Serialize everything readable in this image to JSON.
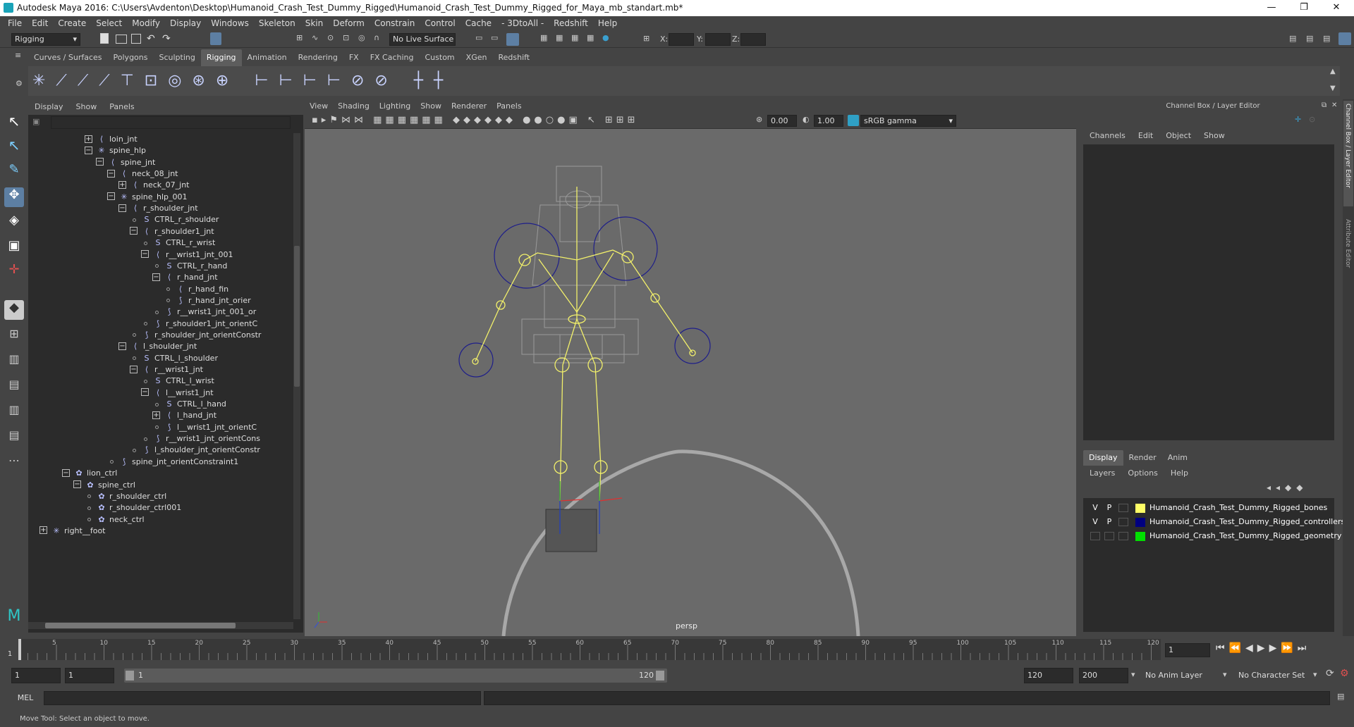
{
  "window": {
    "title": "Autodesk Maya 2016: C:\\Users\\Avdenton\\Desktop\\Humanoid_Crash_Test_Dummy_Rigged\\Humanoid_Crash_Test_Dummy_Rigged_for_Maya_mb_standart.mb*",
    "min": "—",
    "max": "❐",
    "close": "✕"
  },
  "menubar": [
    "File",
    "Edit",
    "Create",
    "Select",
    "Modify",
    "Display",
    "Windows",
    "Skeleton",
    "Skin",
    "Deform",
    "Constrain",
    "Control",
    "Cache",
    "- 3DtoAll -",
    "Redshift",
    "Help"
  ],
  "statusline": {
    "menuset": "Rigging",
    "live_surface": "No Live Surface",
    "x_label": "X:",
    "y_label": "Y:",
    "z_label": "Z:"
  },
  "shelf_tabs": [
    "Curves / Surfaces",
    "Polygons",
    "Sculpting",
    "Rigging",
    "Animation",
    "Rendering",
    "FX",
    "FX Caching",
    "Custom",
    "XGen",
    "Redshift"
  ],
  "active_shelf": "Rigging",
  "outliner": {
    "menu": [
      "Display",
      "Show",
      "Panels"
    ],
    "rows": [
      {
        "label": "loin_jnt",
        "icon": "joint",
        "exp": "+"
      },
      {
        "label": "spine_hlp",
        "icon": "helper",
        "exp": "−"
      },
      {
        "label": "spine_jnt",
        "icon": "joint",
        "exp": "−"
      },
      {
        "label": "neck_08_jnt",
        "icon": "joint",
        "exp": "−"
      },
      {
        "label": "neck_07_jnt",
        "icon": "joint",
        "exp": "+"
      },
      {
        "label": "spine_hlp_001",
        "icon": "helper",
        "exp": "−"
      },
      {
        "label": "r_shoulder_jnt",
        "icon": "joint",
        "exp": "−"
      },
      {
        "label": "CTRL_r_shoulder",
        "icon": "curve",
        "exp": ""
      },
      {
        "label": "r_shoulder1_jnt",
        "icon": "joint",
        "exp": "−"
      },
      {
        "label": "CTRL_r_wrist",
        "icon": "curve",
        "exp": ""
      },
      {
        "label": "r__wrist1_jnt_001",
        "icon": "joint",
        "exp": "−"
      },
      {
        "label": "CTRL_r_hand",
        "icon": "curve",
        "exp": ""
      },
      {
        "label": "r_hand_jnt",
        "icon": "joint",
        "exp": "−"
      },
      {
        "label": "r_hand_fin",
        "icon": "joint",
        "exp": ""
      },
      {
        "label": "r_hand_jnt_orier",
        "icon": "constraint",
        "exp": ""
      },
      {
        "label": "r__wrist1_jnt_001_or",
        "icon": "constraint",
        "exp": ""
      },
      {
        "label": "r_shoulder1_jnt_orientC",
        "icon": "constraint",
        "exp": ""
      },
      {
        "label": "r_shoulder_jnt_orientConstr",
        "icon": "constraint",
        "exp": ""
      },
      {
        "label": "l_shoulder_jnt",
        "icon": "joint",
        "exp": "−"
      },
      {
        "label": "CTRL_l_shoulder",
        "icon": "curve",
        "exp": ""
      },
      {
        "label": "r__wrist1_jnt",
        "icon": "joint",
        "exp": "−"
      },
      {
        "label": "CTRL_l_wrist",
        "icon": "curve",
        "exp": ""
      },
      {
        "label": "l__wrist1_jnt",
        "icon": "joint",
        "exp": "−"
      },
      {
        "label": "CTRL_l_hand",
        "icon": "curve",
        "exp": ""
      },
      {
        "label": "l_hand_jnt",
        "icon": "joint",
        "exp": "+"
      },
      {
        "label": "l__wrist1_jnt_orientC",
        "icon": "constraint",
        "exp": ""
      },
      {
        "label": "r__wrist1_jnt_orientCons",
        "icon": "constraint",
        "exp": ""
      },
      {
        "label": "l_shoulder_jnt_orientConstr",
        "icon": "constraint",
        "exp": ""
      },
      {
        "label": "spine_jnt_orientConstraint1",
        "icon": "constraint",
        "exp": ""
      },
      {
        "label": "lion_ctrl",
        "icon": "ctrl",
        "exp": "−"
      },
      {
        "label": "spine_ctrl",
        "icon": "ctrl",
        "exp": "−"
      },
      {
        "label": "r_shoulder_ctrl",
        "icon": "ctrl",
        "exp": ""
      },
      {
        "label": "r_shoulder_ctrl001",
        "icon": "ctrl",
        "exp": ""
      },
      {
        "label": "neck_ctrl",
        "icon": "ctrl",
        "exp": ""
      },
      {
        "label": "right__foot",
        "icon": "helper",
        "exp": "+"
      }
    ]
  },
  "viewport": {
    "menu": [
      "View",
      "Shading",
      "Lighting",
      "Show",
      "Renderer",
      "Panels"
    ],
    "near_value": "0.00",
    "far_value": "1.00",
    "color_space": "sRGB gamma",
    "camera_label": "persp",
    "colors": {
      "bg": "#6a6a6a",
      "bone": "#f2f06a",
      "ctrl": "#1e1e8a",
      "wire": "#a8a8a8"
    }
  },
  "channel_box": {
    "title": "Channel Box / Layer Editor",
    "menu": [
      "Channels",
      "Edit",
      "Object",
      "Show"
    ],
    "side_tabs": [
      "Channel Box / Layer Editor",
      "Attribute Editor"
    ],
    "layer_tabs": [
      "Display",
      "Render",
      "Anim"
    ],
    "layer_menu": [
      "Layers",
      "Options",
      "Help"
    ],
    "layers": [
      {
        "v": "V",
        "p": "P",
        "name": "Humanoid_Crash_Test_Dummy_Rigged_bones",
        "color": "#ffff66"
      },
      {
        "v": "V",
        "p": "P",
        "name": "Humanoid_Crash_Test_Dummy_Rigged_controllers",
        "color": "#000080"
      },
      {
        "v": "",
        "p": "",
        "name": "Humanoid_Crash_Test_Dummy_Rigged_geometry",
        "color": "#00e000"
      }
    ]
  },
  "timeline": {
    "ticks": [
      "5",
      "10",
      "15",
      "20",
      "25",
      "30",
      "35",
      "40",
      "45",
      "50",
      "55",
      "60",
      "65",
      "70",
      "75",
      "80",
      "85",
      "90",
      "95",
      "100",
      "105",
      "110",
      "115",
      "120"
    ],
    "start_marker": "1",
    "current_frame": "1"
  },
  "range": {
    "start": "1",
    "anim_start": "1",
    "slider_start": "1",
    "slider_end": "120",
    "anim_end": "120",
    "end": "200",
    "anim_layer": "No Anim Layer",
    "character_set": "No Character Set"
  },
  "command": {
    "lang": "MEL"
  },
  "help_line": "Move Tool: Select an object to move."
}
